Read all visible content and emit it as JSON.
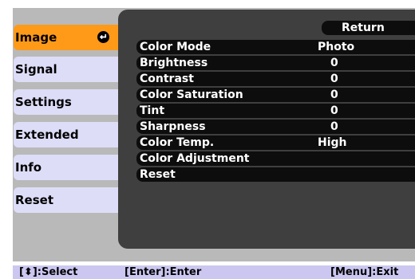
{
  "sidebar": {
    "items": [
      {
        "label": "Image"
      },
      {
        "label": "Signal"
      },
      {
        "label": "Settings"
      },
      {
        "label": "Extended"
      },
      {
        "label": "Info"
      },
      {
        "label": "Reset"
      }
    ]
  },
  "content": {
    "return_label": "Return",
    "rows": [
      {
        "label": "Color Mode",
        "value": "Photo"
      },
      {
        "label": "Brightness",
        "value": "0"
      },
      {
        "label": "Contrast",
        "value": "0"
      },
      {
        "label": "Color Saturation",
        "value": "0"
      },
      {
        "label": "Tint",
        "value": "0"
      },
      {
        "label": "Sharpness",
        "value": "0"
      },
      {
        "label": "Color Temp.",
        "value": "High"
      },
      {
        "label": "Color Adjustment",
        "value": ""
      },
      {
        "label": "Reset",
        "value": ""
      }
    ]
  },
  "footer": {
    "select_hint": "[⬍]:Select",
    "enter_hint": "[Enter]:Enter",
    "exit_hint": "[Menu]:Exit"
  }
}
